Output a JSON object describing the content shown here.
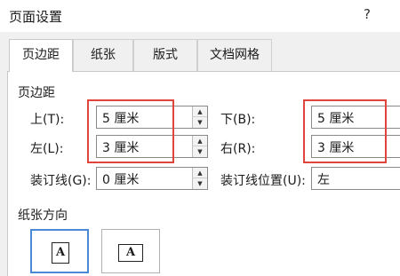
{
  "window": {
    "title": "页面设置",
    "help": "?"
  },
  "tabs": [
    {
      "label": "页边距"
    },
    {
      "label": "纸张"
    },
    {
      "label": "版式"
    },
    {
      "label": "文档网格"
    }
  ],
  "margins": {
    "section_title": "页边距",
    "top_label": "上(T):",
    "top_value": "5 厘米",
    "bottom_label": "下(B):",
    "bottom_value": "5 厘米",
    "left_label": "左(L):",
    "left_value": "3 厘米",
    "right_label": "右(R):",
    "right_value": "3 厘米",
    "gutter_label": "装订线(G):",
    "gutter_value": "0 厘米",
    "gutter_pos_label": "装订线位置(U):",
    "gutter_pos_value": "左"
  },
  "orientation": {
    "section_title": "纸张方向",
    "portrait_glyph": "A",
    "landscape_glyph": "A"
  },
  "colors": {
    "highlight": "#e0443c",
    "selection": "#4a88d8"
  },
  "icons": {
    "spin_up": "triangle-up",
    "spin_down": "triangle-down"
  }
}
